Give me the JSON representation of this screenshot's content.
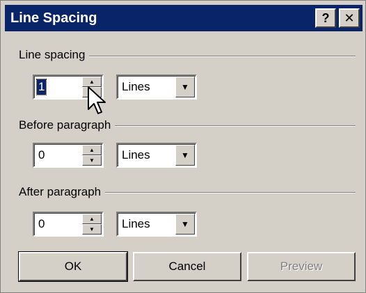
{
  "window": {
    "title": "Line Spacing",
    "help_glyph": "?",
    "close_glyph": "✕"
  },
  "sections": [
    {
      "label": "Line spacing",
      "value": "1",
      "unit": "Lines",
      "value_selected": true
    },
    {
      "label": "Before paragraph",
      "value": "0",
      "unit": "Lines",
      "value_selected": false
    },
    {
      "label": "After paragraph",
      "value": "0",
      "unit": "Lines",
      "value_selected": false
    }
  ],
  "buttons": {
    "ok": "OK",
    "cancel": "Cancel",
    "preview": "Preview"
  },
  "icons": {
    "spin_up": "spin-up-arrow-icon",
    "spin_down": "spin-down-arrow-icon",
    "dropdown": "chevron-down-icon",
    "cursor": "mouse-pointer-icon"
  },
  "colors": {
    "titlebar": "#0a246a",
    "face": "#d4d0c8",
    "selection": "#0a246a"
  }
}
